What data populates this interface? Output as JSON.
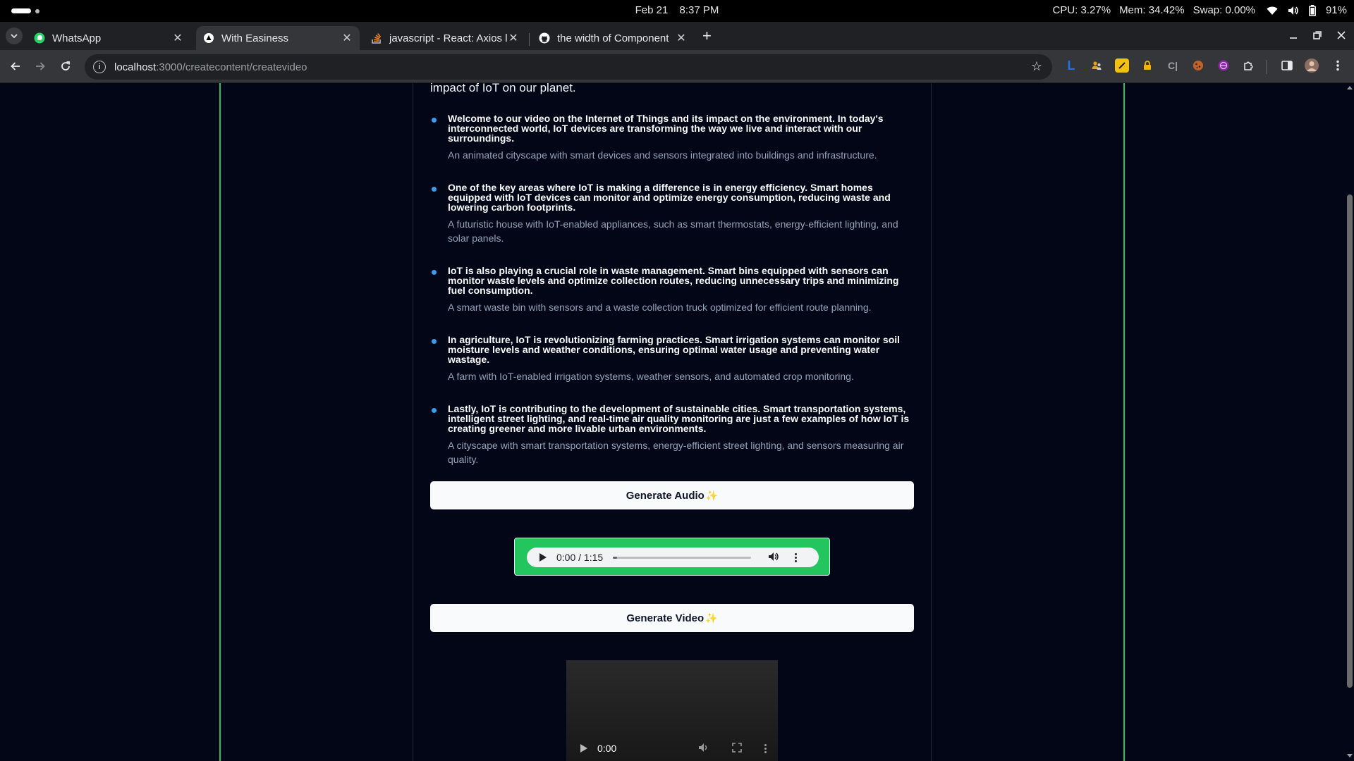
{
  "os": {
    "date": "Feb 21",
    "time": "8:37 PM",
    "cpu": "CPU: 3.27%",
    "mem": "Mem: 34.42%",
    "swap": "Swap: 0.00%",
    "battery": "91%"
  },
  "tabs": [
    {
      "label": "WhatsApp",
      "icon": "whatsapp-icon"
    },
    {
      "label": "With Easiness",
      "icon": "site-icon",
      "active": true
    },
    {
      "label": "javascript - React: Axios l",
      "icon": "stackoverflow-icon"
    },
    {
      "label": "the width of Component",
      "icon": "github-icon"
    }
  ],
  "address": {
    "host": "localhost",
    "path": ":3000/createcontent/createvideo"
  },
  "content": {
    "intro": "impact of IoT on our planet.",
    "scenes": [
      {
        "narration": "Welcome to our video on the Internet of Things and its impact on the environment. In today's interconnected world, IoT devices are transforming the way we live and interact with our surroundings.",
        "visual": "An animated cityscape with smart devices and sensors integrated into buildings and infrastructure."
      },
      {
        "narration": "One of the key areas where IoT is making a difference is in energy efficiency. Smart homes equipped with IoT devices can monitor and optimize energy consumption, reducing waste and lowering carbon footprints.",
        "visual": "A futuristic house with IoT-enabled appliances, such as smart thermostats, energy-efficient lighting, and solar panels."
      },
      {
        "narration": "IoT is also playing a crucial role in waste management. Smart bins equipped with sensors can monitor waste levels and optimize collection routes, reducing unnecessary trips and minimizing fuel consumption.",
        "visual": "A smart waste bin with sensors and a waste collection truck optimized for efficient route planning."
      },
      {
        "narration": "In agriculture, IoT is revolutionizing farming practices. Smart irrigation systems can monitor soil moisture levels and weather conditions, ensuring optimal water usage and preventing water wastage.",
        "visual": "A farm with IoT-enabled irrigation systems, weather sensors, and automated crop monitoring."
      },
      {
        "narration": "Lastly, IoT is contributing to the development of sustainable cities. Smart transportation systems, intelligent street lighting, and real-time air quality monitoring are just a few examples of how IoT is creating greener and more livable urban environments.",
        "visual": "A cityscape with smart transportation systems, energy-efficient street lighting, and sensors measuring air quality."
      }
    ],
    "generate_audio": "Generate Audio",
    "generate_video": "Generate Video",
    "audio_time": "0:00 / 1:15",
    "audio_progress": 0.03,
    "video_time": "0:00"
  },
  "colors": {
    "accent_green": "#22c55e",
    "bullet_blue": "#3b9cf0",
    "page_bg": "#020617"
  }
}
